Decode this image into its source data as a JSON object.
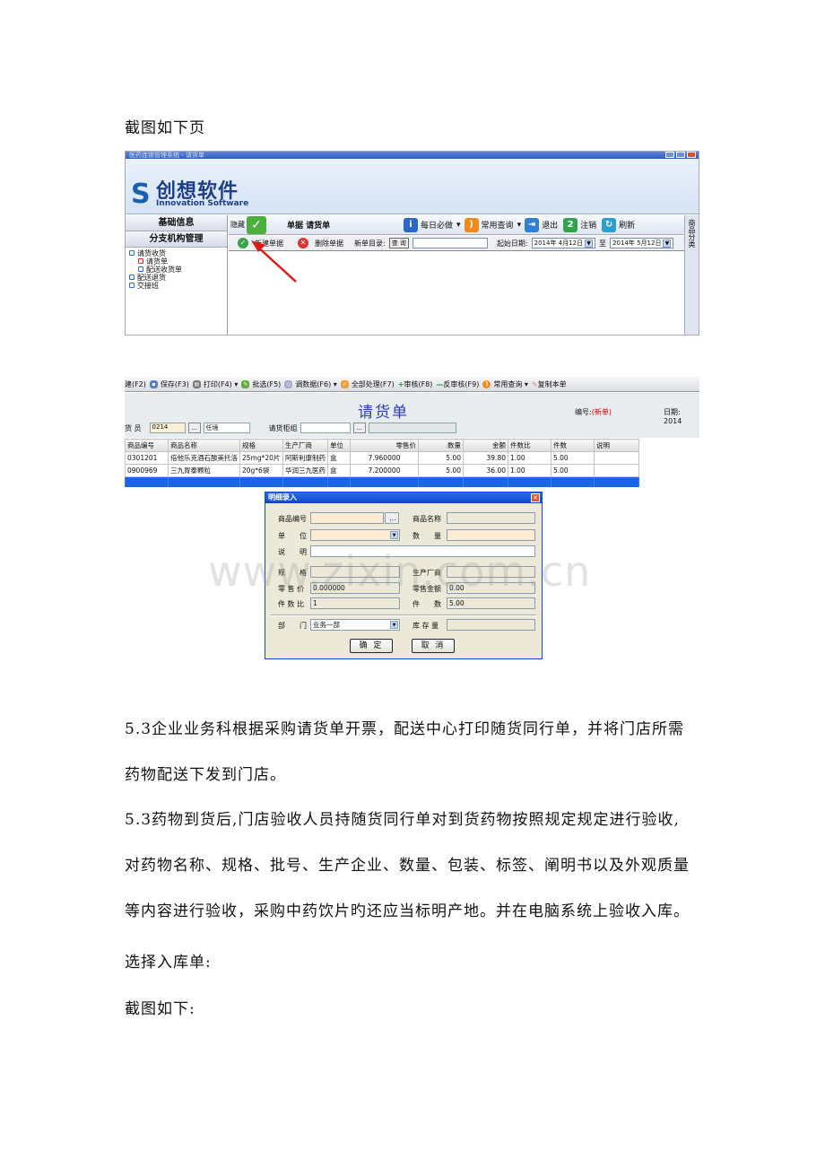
{
  "intro_heading": "截图如下页",
  "shot1": {
    "titlebar": "医药连锁管理系统 - 请货单",
    "logo_cn": "创想软件",
    "logo_en": "Innovation Software",
    "nav": {
      "section1": "基础信息",
      "section2": "分支机构管理",
      "tree": [
        "请货收货",
        "请货单",
        "配送收货单",
        "配送退货",
        "交接班"
      ]
    },
    "toolbar": {
      "hide_label": "隐藏",
      "doc_label": "单据  请货单",
      "daily_label": "每日必做",
      "query_label": "常用查询",
      "exit_label": "退出",
      "logout_label": "注销",
      "refresh_label": "刷新"
    },
    "subbar": {
      "new_label": "新建单据",
      "delete_label": "删除单据",
      "catalog_label": "新单目录:",
      "query_btn": "查 询",
      "start_label": "起始日期:",
      "start_value": "2014年 4月12日",
      "to_label": "至",
      "end_value": "2014年 5月12日"
    },
    "right_strip": "商品分类"
  },
  "shot2": {
    "toolbar": [
      "建(F2)",
      "保存(F3)",
      "打印(F4)",
      "批选(F5)",
      "调数据(F6)",
      "全部处理(F7)",
      "审核(F8)",
      "反审核(F9)",
      "常用查询",
      "复制本单"
    ],
    "doc_title": "请货单",
    "no_label": "编号:",
    "no_value": "(新单)",
    "date_label": "日期: 2014",
    "clerk_label": "货 员",
    "clerk_code": "0214",
    "clerk_name": "任境",
    "group_label": "请货柜组",
    "columns": [
      "商品编号",
      "商品名称",
      "规格",
      "生产厂商",
      "单位",
      "零售价",
      "数量",
      "金额",
      "件数比",
      "件数",
      "说明"
    ],
    "rows": [
      [
        "0301201",
        "倍他乐克酒石酸美托洛",
        "25mg*20片",
        "阿斯利康制药",
        "盒",
        "7.960000",
        "5.00",
        "39.80",
        "1.00",
        "5.00",
        ""
      ],
      [
        "0900969",
        "三九胃泰颗粒",
        "20g*6袋",
        "华润三九医药",
        "盒",
        "7.200000",
        "5.00",
        "36.00",
        "1.00",
        "5.00",
        ""
      ]
    ]
  },
  "dialog": {
    "title": "明细录入",
    "labels": {
      "code": "商品编号",
      "name": "商品名称",
      "unit": "单　　位",
      "qty": "数　　量",
      "desc": "说　　明",
      "spec": "规　　格",
      "maker": "生产厂商",
      "price": "零 售 价",
      "amount": "零售金额",
      "ratio": "件 数 比",
      "pieces": "件　　数",
      "dept": "部　　门",
      "stock": "库 存 量"
    },
    "values": {
      "price": "0.000000",
      "amount": "0.00",
      "ratio": "1",
      "pieces": "5.00",
      "dept": "业务一部"
    },
    "ok": "确 定",
    "cancel": "取 消"
  },
  "watermark": "www.zixin.com.cn",
  "paragraphs": {
    "p1_line1": "5.3企业业务科根据采购请货单开票，配送中心打印随货同行单，并将门店所需",
    "p1_line2": "药物配送下发到门店。",
    "p2_line1": "5.3药物到货后,门店验收人员持随货同行单对到货药物按照规定规定进行验收,",
    "p2_line2": "对药物名称、规格、批号、生产企业、数量、包装、标签、阐明书以及外观质量",
    "p2_line3": "等内容进行验收，采购中药饮片旳还应当标明产地。并在电脑系统上验收入库。",
    "p3": "选择入库单:",
    "p4": "截图如下:"
  }
}
